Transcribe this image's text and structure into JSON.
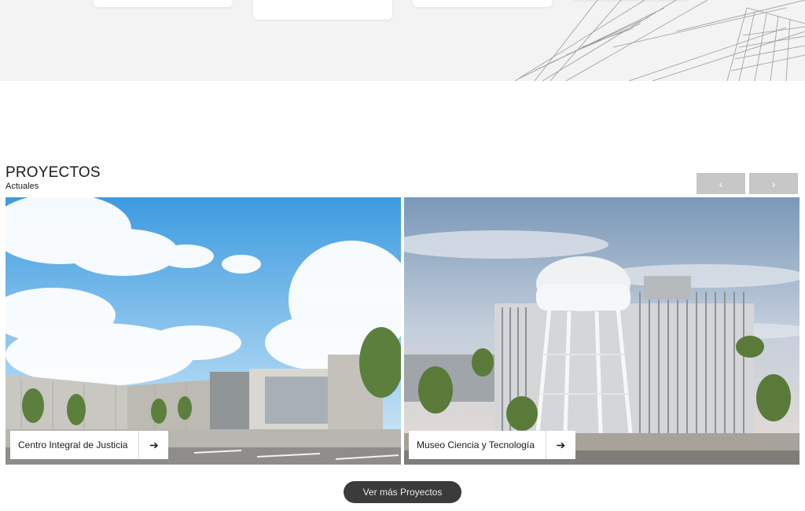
{
  "section": {
    "title": "PROYECTOS",
    "subtitle": "Actuales"
  },
  "carousel": {
    "prev_label": "‹",
    "next_label": "›"
  },
  "projects": [
    {
      "name": "Centro Integral de Justicia",
      "arrow": "➔"
    },
    {
      "name": "Museo Ciencia y Tecnología",
      "arrow": "➔"
    }
  ],
  "more_button": {
    "label": "Ver más Proyectos"
  },
  "colors": {
    "nav_button": "#c7c7c7",
    "more_button": "#3b3b3b",
    "top_band": "#f3f3f3"
  }
}
